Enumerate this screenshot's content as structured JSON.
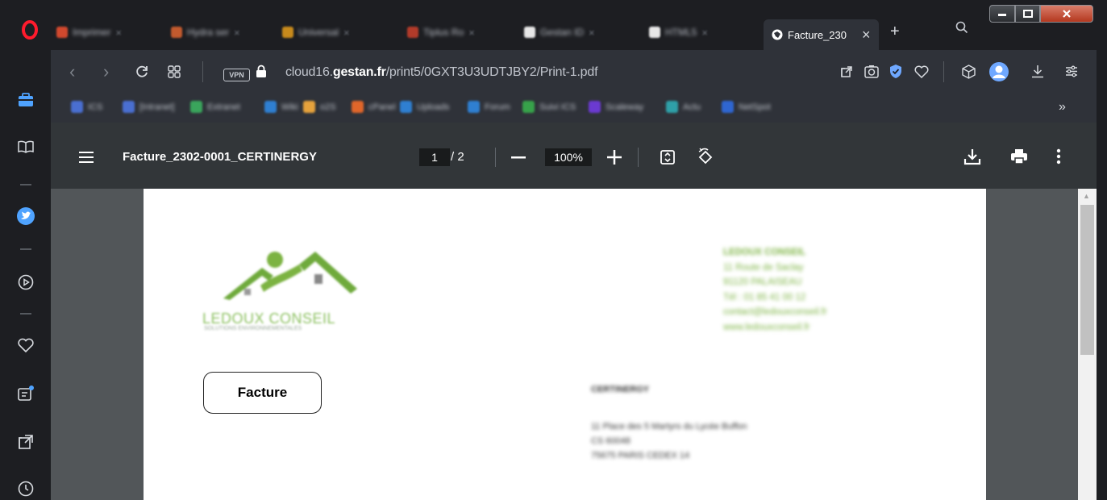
{
  "tabs": [
    {
      "title": "Imprimer",
      "color": "#d1492e"
    },
    {
      "title": "Hydra ser",
      "color": "#c25a2e"
    },
    {
      "title": "Universal",
      "color": "#c78a1c"
    },
    {
      "title": "Tiplus Ro",
      "color": "#b23b2a"
    },
    {
      "title": "Gestan ID",
      "color": "#e7e7e7"
    },
    {
      "title": "HTML5",
      "color": "#e7e7e7"
    }
  ],
  "active_tab": {
    "title": "Facture_230",
    "close_icon": "×"
  },
  "address_bar": {
    "vpn_label": "VPN",
    "url_prefix": "cloud16.",
    "url_domain": "gestan.fr",
    "url_path": "/print5/0GXT3U3UDTJBY2/Print-1.pdf"
  },
  "bookmarks": [
    {
      "title": "ICS",
      "color": "#4a6fd1"
    },
    {
      "title": "[Intranet]",
      "color": "#4a6fd1"
    },
    {
      "title": "Extranet",
      "color": "#3aa55c"
    },
    {
      "title": "Wiki",
      "color": "#2f7fd1"
    },
    {
      "title": "o2S",
      "color": "#e6a23c"
    },
    {
      "title": "cPanel",
      "color": "#e0662a"
    },
    {
      "title": "Uploads",
      "color": "#2f7fd1"
    },
    {
      "title": "Forum",
      "color": "#2f7fd1"
    },
    {
      "title": "Suivi ICS",
      "color": "#37a24a"
    },
    {
      "title": "Scaleway",
      "color": "#6b3ad1"
    },
    {
      "title": "Actu",
      "color": "#2fa0a8"
    },
    {
      "title": "NetSpot",
      "color": "#2f66d1"
    }
  ],
  "bookmarks_more": "»",
  "pdf_toolbar": {
    "title": "Facture_2302-0001_CERTINERGY",
    "page_current": "1",
    "page_total": "/ 2",
    "zoom": "100%"
  },
  "document": {
    "logo_text": "LEDOUX CONSEIL",
    "logo_subtitle": "SOLUTIONS ENVIRONNEMENTALES",
    "company": {
      "name": "LEDOUX CONSEIL",
      "lines": [
        "11 Route de Saclay",
        "91120 PALAISEAU",
        "Tél : 01 85 41 00 12",
        "contact@ledouxconseil.fr",
        "www.ledouxconseil.fr"
      ]
    },
    "facture_label": "Facture",
    "client": {
      "name": "CERTINERGY",
      "lines": [
        "11 Place des 5 Martyrs du Lycée Buffon",
        "CS 60048",
        "75675 PARIS CEDEX 14"
      ]
    }
  }
}
